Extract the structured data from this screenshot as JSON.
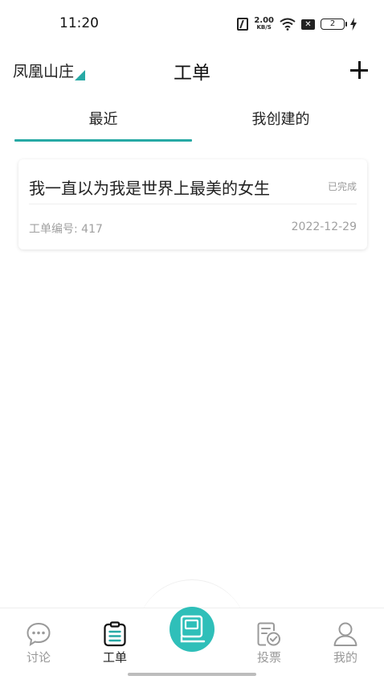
{
  "status_bar": {
    "time": "11:20",
    "net_speed_value": "2.00",
    "net_speed_unit": "KB/S",
    "battery_level": "2",
    "icons": [
      "nfc-icon",
      "wifi-icon",
      "sim-x-icon",
      "battery-icon",
      "charging-bolt-icon"
    ]
  },
  "header": {
    "community": "凤凰山庄",
    "title": "工单",
    "add_icon": "plus-icon"
  },
  "tabs": [
    {
      "label": "最近",
      "active": true
    },
    {
      "label": "我创建的",
      "active": false
    }
  ],
  "work_orders": [
    {
      "title": "我一直以为我是世界上最美的女生",
      "status": "已完成",
      "number_label": "工单编号: 417",
      "date": "2022-12-29"
    }
  ],
  "bottom_nav": {
    "items": [
      {
        "label": "讨论",
        "icon": "chat-bubble-icon",
        "active": false
      },
      {
        "label": "工单",
        "icon": "clipboard-icon",
        "active": true
      },
      {
        "label": "",
        "icon": "center-action-icon",
        "active": false
      },
      {
        "label": "投票",
        "icon": "vote-check-icon",
        "active": false
      },
      {
        "label": "我的",
        "icon": "user-icon",
        "active": false
      }
    ]
  },
  "colors": {
    "accent": "#27a9a5",
    "center_button": "#2fbfb9",
    "muted_text": "#999999"
  }
}
